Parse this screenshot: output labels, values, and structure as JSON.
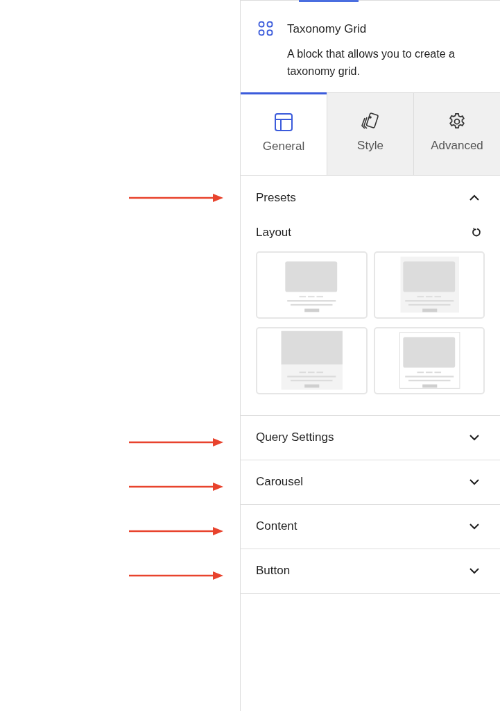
{
  "block": {
    "title": "Taxonomy Grid",
    "description": "A block that allows you to create a taxonomy grid."
  },
  "tabs": [
    {
      "label": "General",
      "kind": "layout",
      "selected": true
    },
    {
      "label": "Style",
      "kind": "style",
      "selected": false
    },
    {
      "label": "Advanced",
      "kind": "gear",
      "selected": false
    }
  ],
  "sections": [
    {
      "title": "Presets",
      "expanded": true,
      "marked": true,
      "layout": {
        "label": "Layout",
        "presets": [
          {
            "kind": "plain"
          },
          {
            "kind": "tinted"
          },
          {
            "kind": "full"
          },
          {
            "kind": "bordered"
          }
        ]
      }
    },
    {
      "title": "Query Settings",
      "expanded": false,
      "marked": true
    },
    {
      "title": "Carousel",
      "expanded": false,
      "marked": true
    },
    {
      "title": "Content",
      "expanded": false,
      "marked": true
    },
    {
      "title": "Button",
      "expanded": false,
      "marked": true
    }
  ]
}
